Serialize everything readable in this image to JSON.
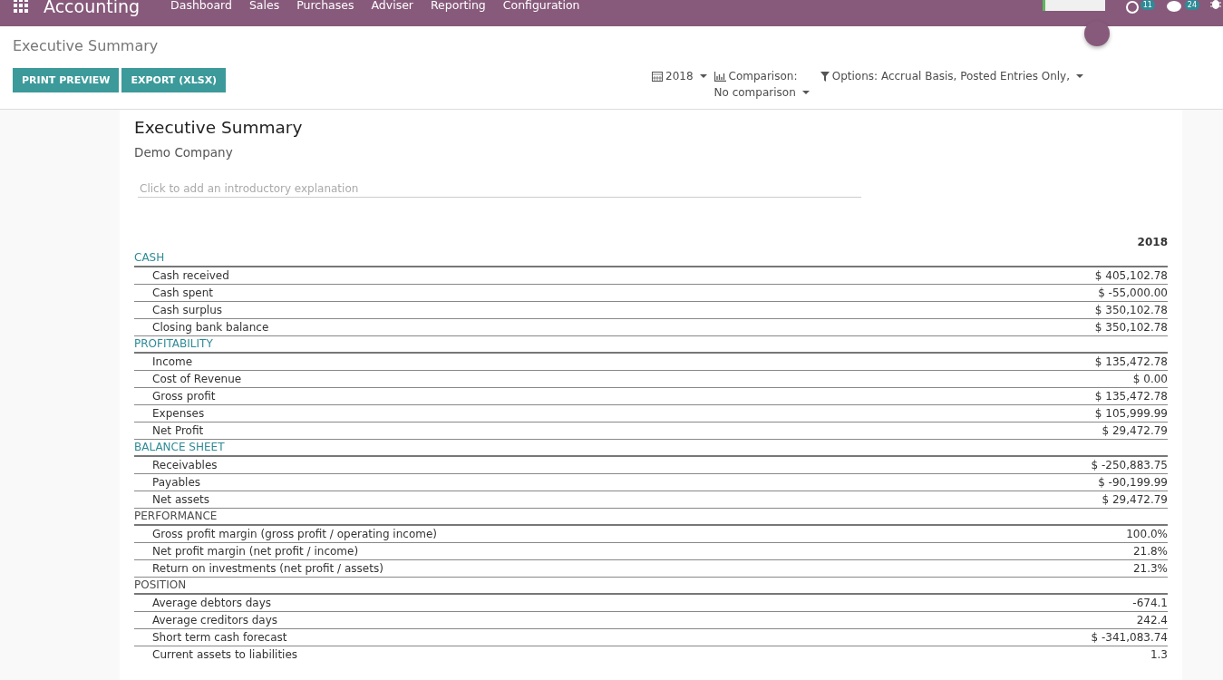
{
  "navbar": {
    "app_title": "Accounting",
    "menu": [
      "Dashboard",
      "Sales",
      "Purchases",
      "Adviser",
      "Reporting",
      "Configuration"
    ],
    "activity_count": "11",
    "message_count": "24"
  },
  "breadcrumb": "Executive Summary",
  "buttons": [
    "PRINT PREVIEW",
    "EXPORT (XLSX)"
  ],
  "filters": {
    "period": "2018",
    "comparison_label": "Comparison:",
    "comparison_value": "No comparison",
    "options": "Options: Accrual Basis, Posted Entries Only,"
  },
  "report": {
    "title": "Executive Summary",
    "company": "Demo Company",
    "intro_placeholder": "Click to add an introductory explanation",
    "column": "2018",
    "sections": [
      {
        "name": "CASH",
        "color": "#2e8b96",
        "lines": [
          {
            "label": "Cash received",
            "value": "$ 405,102.78"
          },
          {
            "label": "Cash spent",
            "value": "$ -55,000.00"
          },
          {
            "label": "Cash surplus",
            "value": "$ 350,102.78"
          },
          {
            "label": "Closing bank balance",
            "value": "$ 350,102.78"
          }
        ]
      },
      {
        "name": "PROFITABILITY",
        "color": "#2e8b96",
        "lines": [
          {
            "label": "Income",
            "value": "$ 135,472.78"
          },
          {
            "label": "Cost of Revenue",
            "value": "$ 0.00"
          },
          {
            "label": "Gross profit",
            "value": "$ 135,472.78"
          },
          {
            "label": "Expenses",
            "value": "$ 105,999.99"
          },
          {
            "label": "Net Profit",
            "value": "$ 29,472.79"
          }
        ]
      },
      {
        "name": "BALANCE SHEET",
        "color": "#2e8b96",
        "lines": [
          {
            "label": "Receivables",
            "value": "$ -250,883.75"
          },
          {
            "label": "Payables",
            "value": "$ -90,199.99"
          },
          {
            "label": "Net assets",
            "value": "$ 29,472.79"
          }
        ]
      },
      {
        "name": "PERFORMANCE",
        "color": "#4c4c4c",
        "lines": [
          {
            "label": "Gross profit margin (gross profit / operating income)",
            "value": "100.0%"
          },
          {
            "label": "Net profit margin (net profit / income)",
            "value": "21.8%"
          },
          {
            "label": "Return on investments (net profit / assets)",
            "value": "21.3%"
          }
        ]
      },
      {
        "name": "POSITION",
        "color": "#4c4c4c",
        "lines": [
          {
            "label": "Average debtors days",
            "value": "-674.1"
          },
          {
            "label": "Average creditors days",
            "value": "242.4"
          },
          {
            "label": "Short term cash forecast",
            "value": "$ -341,083.74"
          },
          {
            "label": "Current assets to liabilities",
            "value": "1.3"
          }
        ]
      }
    ]
  }
}
